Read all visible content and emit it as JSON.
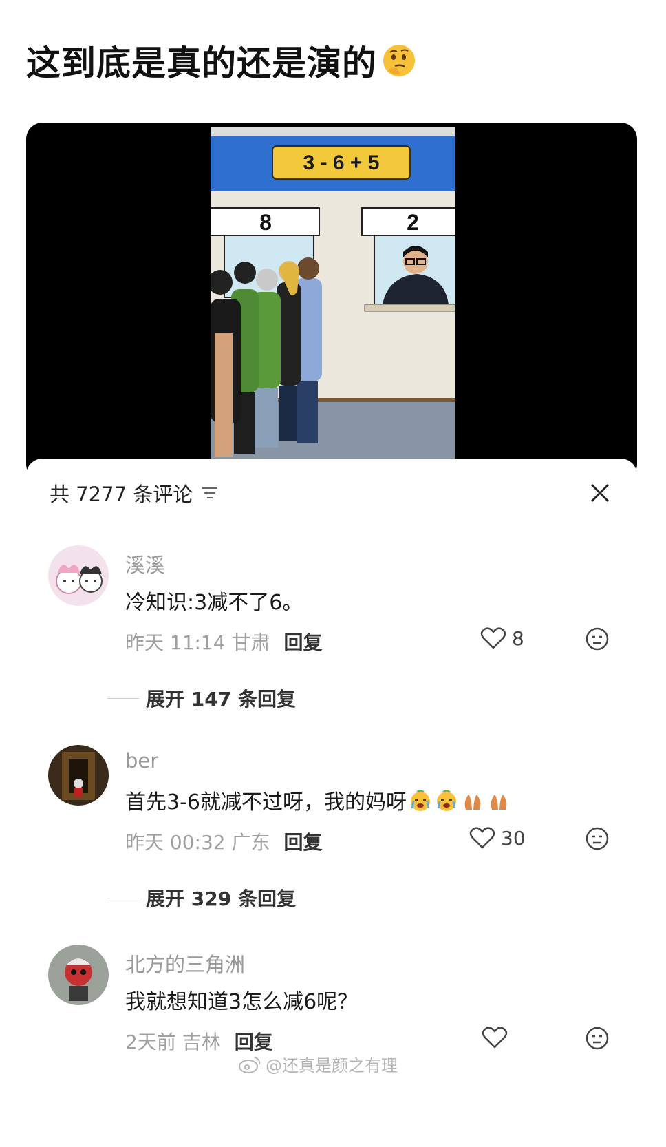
{
  "post": {
    "title": "这到底是真的还是演的",
    "title_emoji": "thinking-face-icon"
  },
  "video": {
    "equation": "3 - 6 + 5",
    "counter_left": "8",
    "counter_right": "2"
  },
  "comments_panel": {
    "header": "共 7277 条评论",
    "sort_icon": "filter-sort-icon",
    "close_icon": "close-icon"
  },
  "comments": [
    {
      "username": "溪溪",
      "text": "冷知识:3减不了6。",
      "time": "昨天 11:14 甘肃",
      "reply_label": "回复",
      "likes": "8",
      "expand": "展开 147 条回复"
    },
    {
      "username": "ber",
      "text": "首先3-6就减不过呀，我的妈呀",
      "time": "昨天 00:32 广东",
      "reply_label": "回复",
      "likes": "30",
      "expand": "展开 329 条回复"
    },
    {
      "username": "北方的三角洲",
      "text": "我就想知道3怎么减6呢？",
      "time": "2天前 吉林",
      "reply_label": "回复",
      "likes": ""
    }
  ],
  "watermark": "@还真是颜之有理",
  "colors": {
    "sign_blue": "#2f6fd0",
    "sign_yellow": "#f2c93a",
    "wall": "#ece7dc",
    "floor": "#8895a6"
  }
}
